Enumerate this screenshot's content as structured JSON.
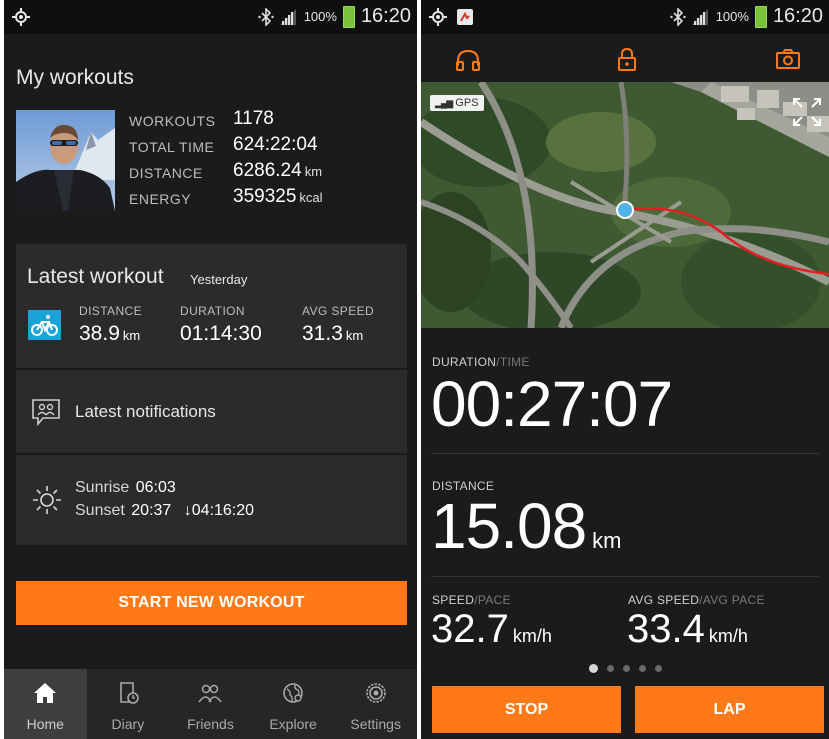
{
  "colors": {
    "accent": "#ff7a17",
    "bike": "#1aa3d9",
    "panel": "#2b2b2b",
    "background": "#1b1b1b"
  },
  "left": {
    "status": {
      "battery": "100%",
      "time": "16:20"
    },
    "title": "My workouts",
    "stats": [
      {
        "label": "WORKOUTS",
        "value": "1178",
        "unit": ""
      },
      {
        "label": "TOTAL TIME",
        "value": "624:22:04",
        "unit": ""
      },
      {
        "label": "DISTANCE",
        "value": "6286.24",
        "unit": "km"
      },
      {
        "label": "ENERGY",
        "value": "359325",
        "unit": "kcal"
      }
    ],
    "latest": {
      "title": "Latest workout",
      "when": "Yesterday",
      "icon": "bike-icon",
      "metrics": [
        {
          "label": "DISTANCE",
          "value": "38.9",
          "unit": "km"
        },
        {
          "label": "DURATION",
          "value": "01:14:30",
          "unit": ""
        },
        {
          "label": "AVG SPEED",
          "value": "31.3",
          "unit": "km"
        }
      ]
    },
    "notifications": {
      "label": "Latest notifications"
    },
    "sun": {
      "sunrise_label": "Sunrise",
      "sunrise": "06:03",
      "sunset_label": "Sunset",
      "sunset": "20:37",
      "daylight": "↓04:16:20"
    },
    "start_button": "START NEW WORKOUT",
    "nav": [
      {
        "label": "Home",
        "icon": "home-icon",
        "active": true
      },
      {
        "label": "Diary",
        "icon": "diary-icon",
        "active": false
      },
      {
        "label": "Friends",
        "icon": "friends-icon",
        "active": false
      },
      {
        "label": "Explore",
        "icon": "explore-icon",
        "active": false
      },
      {
        "label": "Settings",
        "icon": "settings-icon",
        "active": false
      }
    ]
  },
  "right": {
    "status": {
      "battery": "100%",
      "time": "16:20"
    },
    "toolbar": [
      "headphones-icon",
      "lock-icon",
      "camera-icon"
    ],
    "map": {
      "gps": "GPS"
    },
    "duration": {
      "label": "DURATION",
      "alt": "/TIME",
      "value": "00:27:07"
    },
    "distance": {
      "label": "DISTANCE",
      "value": "15.08",
      "unit": "km"
    },
    "speed": {
      "label": "SPEED",
      "alt": "/PACE",
      "value": "32.7",
      "unit": "km/h"
    },
    "avg_speed": {
      "label": "AVG SPEED",
      "alt": "/AVG PACE",
      "value": "33.4",
      "unit": "km/h"
    },
    "pager": {
      "pages": 5,
      "active": 1
    },
    "stop_button": "STOP",
    "lap_button": "LAP"
  }
}
